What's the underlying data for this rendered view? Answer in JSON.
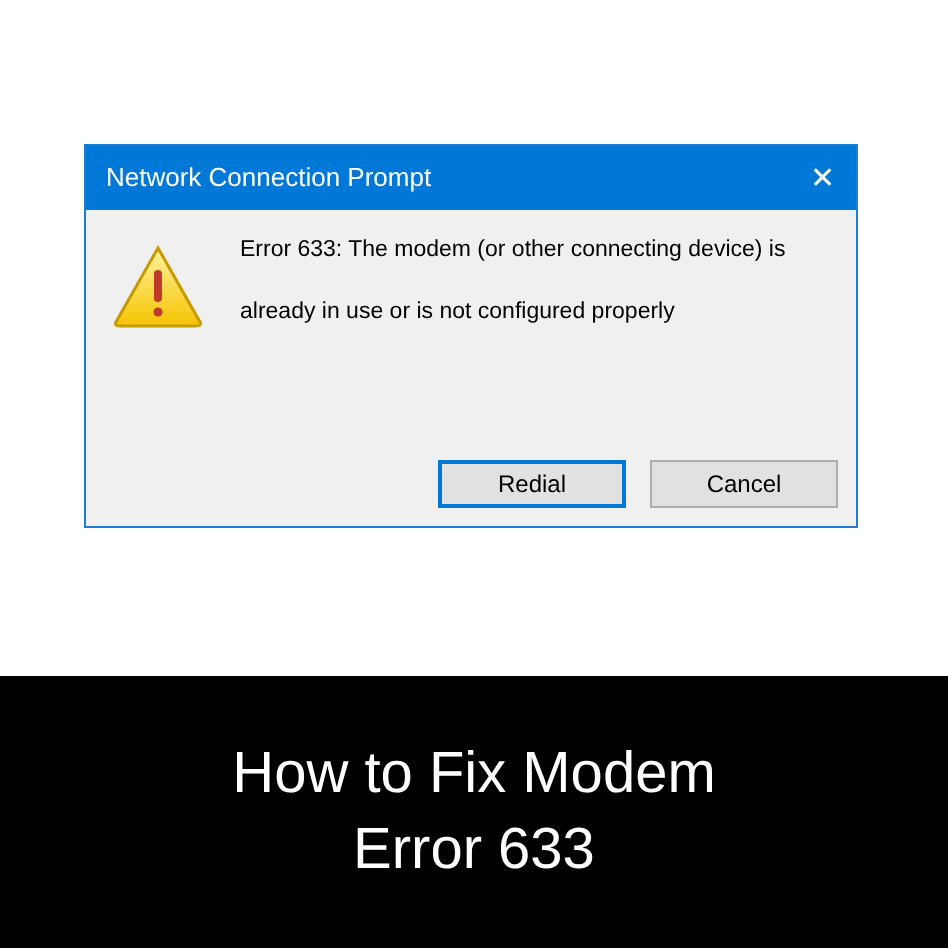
{
  "dialog": {
    "title": "Network Connection Prompt",
    "close": "✕",
    "message_lines": [
      "Error 633: The modem (or other connecting device) is",
      "already in use or is not configured properly"
    ],
    "buttons": [
      {
        "label": "Redial",
        "default": true
      },
      {
        "label": "Cancel",
        "default": false
      }
    ]
  },
  "caption": {
    "lines": [
      "How to Fix Modem",
      "Error 633"
    ]
  }
}
